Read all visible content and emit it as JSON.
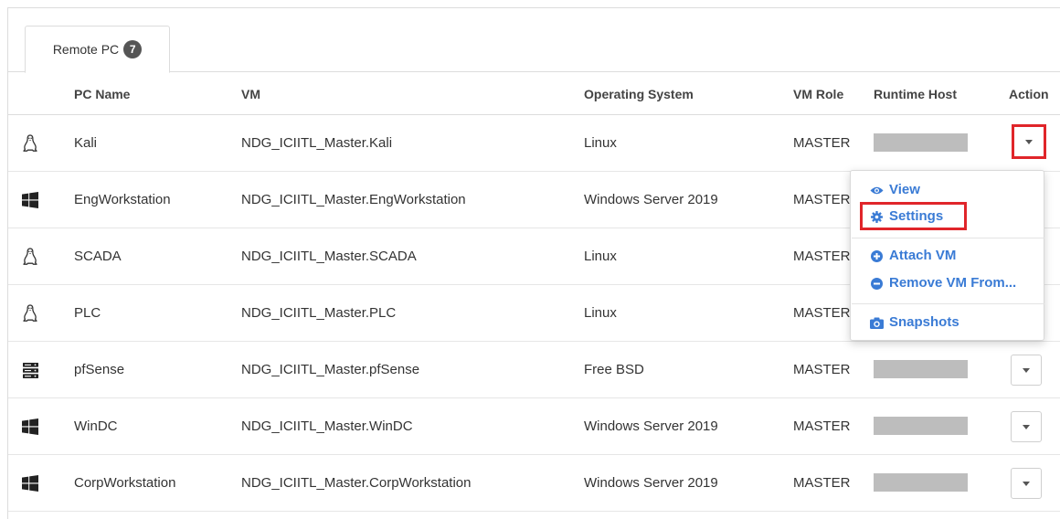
{
  "tabs": [
    {
      "label": "Remote PC",
      "count": "7"
    }
  ],
  "columns": {
    "pc_name": "PC Name",
    "vm": "VM",
    "os": "Operating System",
    "role": "VM Role",
    "host": "Runtime Host",
    "action": "Action"
  },
  "rows": [
    {
      "icon": "linux-icon",
      "pc_name": "Kali",
      "vm": "NDG_ICIITL_Master.Kali",
      "os": "Linux",
      "role": "MASTER"
    },
    {
      "icon": "windows-icon",
      "pc_name": "EngWorkstation",
      "vm": "NDG_ICIITL_Master.EngWorkstation",
      "os": "Windows Server 2019",
      "role": "MASTER"
    },
    {
      "icon": "linux-icon",
      "pc_name": "SCADA",
      "vm": "NDG_ICIITL_Master.SCADA",
      "os": "Linux",
      "role": "MASTER"
    },
    {
      "icon": "linux-icon",
      "pc_name": "PLC",
      "vm": "NDG_ICIITL_Master.PLC",
      "os": "Linux",
      "role": "MASTER"
    },
    {
      "icon": "server-icon",
      "pc_name": "pfSense",
      "vm": "NDG_ICIITL_Master.pfSense",
      "os": "Free BSD",
      "role": "MASTER"
    },
    {
      "icon": "windows-icon",
      "pc_name": "WinDC",
      "vm": "NDG_ICIITL_Master.WinDC",
      "os": "Windows Server 2019",
      "role": "MASTER"
    },
    {
      "icon": "windows-icon",
      "pc_name": "CorpWorkstation",
      "vm": "NDG_ICIITL_Master.CorpWorkstation",
      "os": "Windows Server 2019",
      "role": "MASTER"
    }
  ],
  "action_menu": {
    "items": [
      {
        "label": "View",
        "icon": "eye-icon"
      },
      {
        "label": "Settings",
        "icon": "gear-icon"
      },
      {
        "label": "Attach VM",
        "icon": "plus-circle-icon"
      },
      {
        "label": "Remove VM From...",
        "icon": "minus-circle-icon"
      },
      {
        "label": "Snapshots",
        "icon": "camera-icon"
      }
    ]
  },
  "colors": {
    "highlight": "#e0252a",
    "menu_link": "#3a7bd5",
    "redacted": "#bdbdbd"
  }
}
